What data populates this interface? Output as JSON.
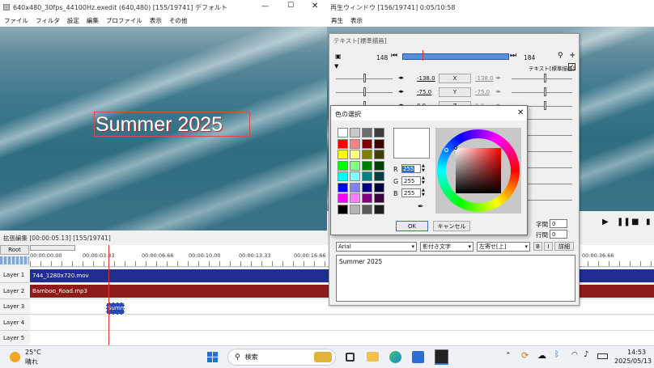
{
  "main_window": {
    "title": "640x480_30fps_44100Hz.exedit (640,480)  [155/19741]  デフォルト",
    "menu": [
      "ファイル",
      "フィルタ",
      "設定",
      "編集",
      "プロファイル",
      "表示",
      "その他"
    ],
    "overlay_text": "Summer 2025"
  },
  "playback_window": {
    "title": "再生ウィンドウ  [156/19741]  0:05/10:58",
    "menu": [
      "再生",
      "表示"
    ]
  },
  "text_dialog": {
    "title": "テキスト[標準描画]",
    "frame_start": "148",
    "frame_end": "184",
    "mode_label": "テキスト[標準描画]",
    "params": [
      {
        "label": "X",
        "left": "-138.0",
        "right": "-138.0"
      },
      {
        "label": "Y",
        "left": "-75.0",
        "right": "-75.0"
      },
      {
        "label": "Z",
        "left": "0.0",
        "right": "0.0"
      }
    ],
    "char_spacing_label": "字間",
    "char_spacing_value": "0",
    "line_spacing_label": "行間",
    "line_spacing_value": "0",
    "bold_label": "B",
    "italic_label": "I",
    "detail_label": "詳細",
    "font": "Arial",
    "style": "影付き文字",
    "align": "左寄せ[上]",
    "text_content": "Summer 2025"
  },
  "color_dialog": {
    "title": "色の選択",
    "swatches": [
      "#ffffff",
      "#c8c8c8",
      "#6e6e6e",
      "#3c3c3c",
      "#ff0000",
      "#ff8080",
      "#800000",
      "#400000",
      "#ffff00",
      "#ffff80",
      "#808000",
      "#404000",
      "#00ff00",
      "#80ff80",
      "#008000",
      "#004000",
      "#00ffff",
      "#80ffff",
      "#008080",
      "#004040",
      "#0000ff",
      "#8080ff",
      "#000080",
      "#000040",
      "#ff00ff",
      "#ff80ff",
      "#800080",
      "#400040",
      "#000000",
      "#b4b4b4",
      "#5a5a5a",
      "#1e1e1e"
    ],
    "r_label": "R",
    "r_value": "255",
    "g_label": "G",
    "g_value": "255",
    "b_label": "B",
    "b_value": "255",
    "ok_label": "OK",
    "cancel_label": "キャンセル"
  },
  "timeline": {
    "title": "拡張編集 [00:00:05.13] [155/19741]",
    "root_label": "Root",
    "ticks": [
      "00:00:00.00",
      "00:00:03.33",
      "00:00:06.66",
      "00:00:10.00",
      "00:00:13.33",
      "00:00:16.66",
      "00:00:36.66"
    ],
    "layers": [
      "Layer 1",
      "Layer 2",
      "Layer 3",
      "Layer 4",
      "Layer 5"
    ],
    "clips": {
      "video": "744_1280x720.mov",
      "audio": "Bamboo_Road.mp3",
      "text": "Summ"
    }
  },
  "taskbar": {
    "weather_temp": "25°C",
    "weather_text": "晴れ",
    "search_placeholder": "検索",
    "time": "14:53",
    "date": "2025/05/13"
  }
}
